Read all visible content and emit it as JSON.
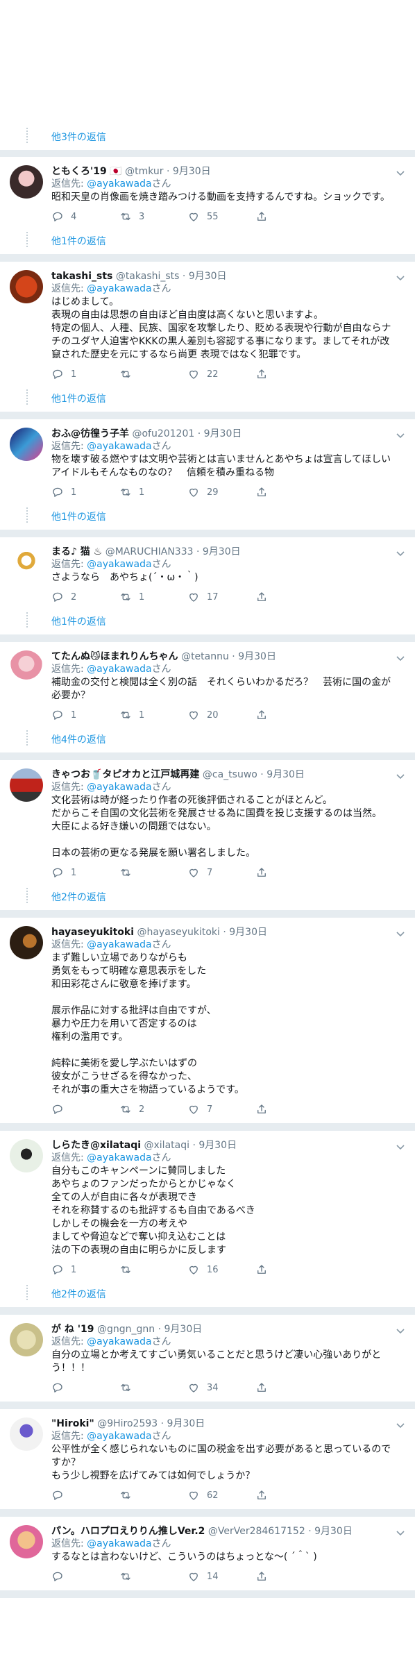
{
  "first_more": "他3件の返信",
  "reply_prefix": "返信先:",
  "reply_suffix": "さん",
  "tweets": [
    {
      "name": "ともくろ'19",
      "flag": "🇯🇵",
      "handle": "@tmkur",
      "date": "9月30日",
      "reply_to": "@ayakawada",
      "text": "昭和天皇の肖像画を焼き踏みつける動画を支持するんですね。ショックです。",
      "reply_count": "4",
      "retweet_count": "3",
      "like_count": "55",
      "more": "他1件の返信"
    },
    {
      "name": "takashi_sts",
      "flag": "",
      "handle": "@takashi_sts",
      "date": "9月30日",
      "reply_to": "@ayakawada",
      "text": "はじめまして。\n表現の自由は思想の自由ほど自由度は高くないと思いますよ。\n特定の個人、人種、民族、国家を攻撃したり、貶める表現や行動が自由ならナチのユダヤ人迫害やKKKの黒人差別も容認する事になります。ましてそれが改竄された歴史を元にするなら尚更 表現ではなく犯罪です。",
      "reply_count": "1",
      "retweet_count": "",
      "like_count": "22",
      "more": "他1件の返信"
    },
    {
      "name": "おふ@彷徨う子羊",
      "flag": "",
      "handle": "@ofu201201",
      "date": "9月30日",
      "reply_to": "@ayakawada",
      "text": "物を壊す破る燃やすは文明や芸術とは言いませんとあやちょは宣言してほしい　アイドルもそんなものなの？　信頼を積み重ねる物",
      "reply_count": "1",
      "retweet_count": "1",
      "like_count": "29",
      "more": "他1件の返信"
    },
    {
      "name": "まる♪ 猫 ♨",
      "flag": "",
      "handle": "@MARUCHIAN333",
      "date": "9月30日",
      "reply_to": "@ayakawada",
      "text": "さようなら　あやちょ(´・ω・｀)",
      "reply_count": "2",
      "retweet_count": "1",
      "like_count": "17",
      "more": "他1件の返信"
    },
    {
      "name": "てたんぬ😼ほまれりんちゃん",
      "flag": "",
      "handle": "@tetannu",
      "date": "9月30日",
      "reply_to": "@ayakawada",
      "text": "補助金の交付と検閲は全く別の話　それくらいわかるだろ？　芸術に国の金が必要か？",
      "reply_count": "1",
      "retweet_count": "1",
      "like_count": "20",
      "more": "他4件の返信"
    },
    {
      "name": "きゃつお🥤タピオカと江戸城再建",
      "flag": "",
      "handle": "@ca_tsuwo",
      "date": "9月30日",
      "reply_to": "@ayakawada",
      "text": "文化芸術は時が経ったり作者の死後評価されることがほとんど。\nだからこそ自国の文化芸術を発展させる為に国費を投じ支援するのは当然。\n大臣による好き嫌いの問題ではない。\n\n日本の芸術の更なる発展を願い署名しました。",
      "reply_count": "1",
      "retweet_count": "",
      "like_count": "7",
      "more": "他2件の返信"
    },
    {
      "name": "hayaseyukitoki",
      "flag": "",
      "handle": "@hayaseyukitoki",
      "date": "9月30日",
      "reply_to": "@ayakawada",
      "text": "まず難しい立場でありながらも\n勇気をもって明確な意思表示をした\n和田彩花さんに敬意を捧げます。\n\n展示作品に対する批評は自由ですが、\n暴力や圧力を用いて否定するのは\n権利の濫用です。\n\n純粋に美術を愛し学ぶたいはずの\n彼女がこうせざるを得なかった、\nそれが事の重大さを物語っているようです。",
      "reply_count": "",
      "retweet_count": "2",
      "like_count": "7",
      "more": ""
    },
    {
      "name": "しらたき@xilataqi",
      "flag": "",
      "handle": "@xilataqi",
      "date": "9月30日",
      "reply_to": "@ayakawada",
      "text": "自分もこのキャンペーンに賛同しました\nあやちょのファンだったからとかじゃなく\n全ての人が自由に各々が表現でき\nそれを称賛するのも批評するも自由であるべき\nしかしその機会を一方の考えや\nましてや脅迫などで奪い抑え込むことは\n法の下の表現の自由に明らかに反します",
      "reply_count": "1",
      "retweet_count": "",
      "like_count": "16",
      "more": "他2件の返信"
    },
    {
      "name": "が ね '19",
      "flag": "",
      "handle": "@gngn_gnn",
      "date": "9月30日",
      "reply_to": "@ayakawada",
      "text": "自分の立場とか考えてすごい勇気いることだと思うけど凄い心強いありがとう！！！",
      "reply_count": "",
      "retweet_count": "",
      "like_count": "34",
      "more": ""
    },
    {
      "name": "\"Hiroki\"",
      "flag": "",
      "handle": "@9Hiro2593",
      "date": "9月30日",
      "reply_to": "@ayakawada",
      "text": "公平性が全く感じられないものに国の税金を出す必要があると思っているのですか？\nもう少し視野を広げてみては如何でしょうか？",
      "reply_count": "",
      "retweet_count": "",
      "like_count": "62",
      "more": ""
    },
    {
      "name": "パン。ハロプロえりりん推しVer.2",
      "flag": "",
      "handle": "@VerVer284617152",
      "date": "9月30日",
      "reply_to": "@ayakawada",
      "text": "するなとは言わないけど、こういうのはちょっとな〜( ´＾` )",
      "reply_count": "",
      "retweet_count": "",
      "like_count": "14",
      "more": ""
    }
  ],
  "icons": {
    "reply": "reply-icon",
    "retweet": "retweet-icon",
    "like": "heart-icon",
    "share": "share-icon",
    "caret": "chevron-down-icon"
  },
  "colors": {
    "link": "#1b95e0",
    "muted": "#657786",
    "separator": "#e6ecf0",
    "text": "#14171a"
  }
}
